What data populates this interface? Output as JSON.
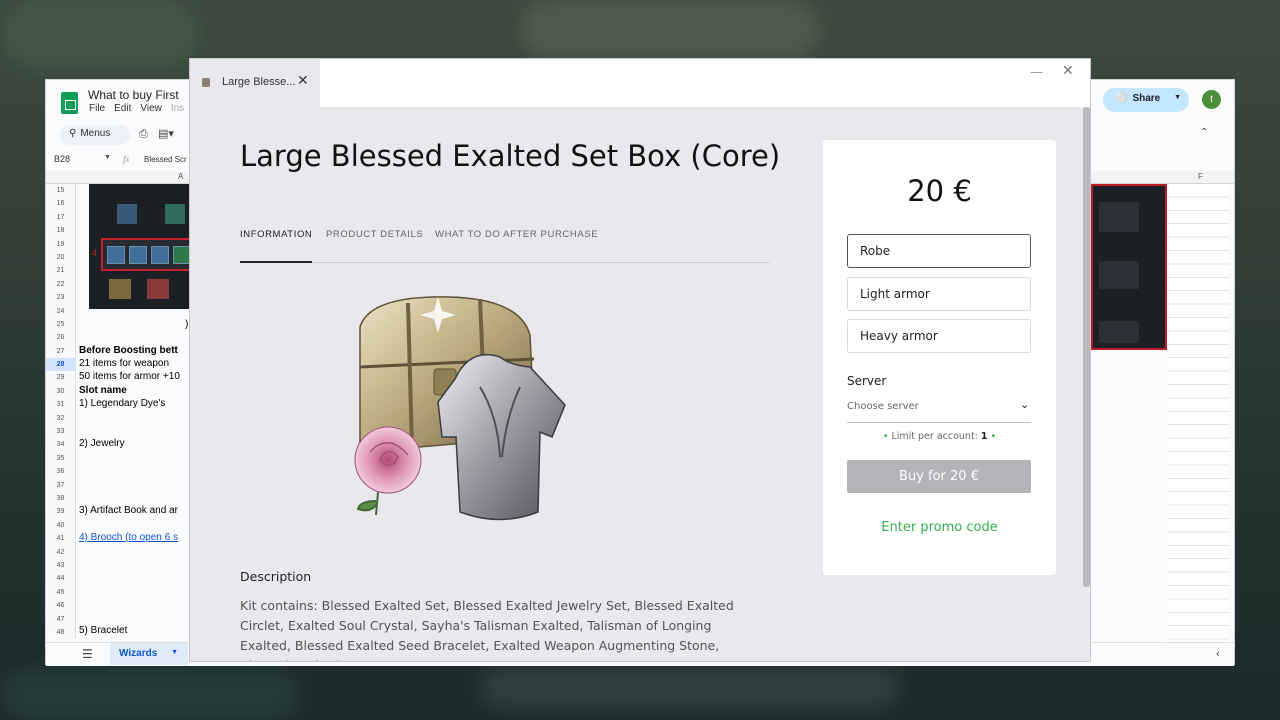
{
  "spreadsheet": {
    "title": "What to buy First",
    "menus": [
      "File",
      "Edit",
      "View",
      "Ins"
    ],
    "search_menus_label": "Menus",
    "name_box": "B28",
    "formula_value": "Blessed Scr",
    "column_a": "A",
    "column_f": "F",
    "share_label": "Share",
    "avatar_letter": "t",
    "row_numbers": [
      "15",
      "16",
      "17",
      "18",
      "19",
      "20",
      "21",
      "22",
      "23",
      "24",
      "25",
      "26",
      "27",
      "28",
      "29",
      "30",
      "31",
      "32",
      "33",
      "34",
      "35",
      "36",
      "37",
      "38",
      "39",
      "40",
      "41",
      "42",
      "43",
      "44",
      "45",
      "46",
      "47",
      "48"
    ],
    "selected_row": "28",
    "cells": {
      "r25": ")",
      "r27": "Before Boosting bett",
      "r28": "21 items for weapon",
      "r29": "50 items for armor +10",
      "r30": "Slot name",
      "r31": "1) Legendary Dye's",
      "r34": "2) Jewelry",
      "r39": "3) Artifact Book and ar",
      "r41": "4) Brooch (to open 6 s",
      "r48": "5) Bracelet",
      "r20": "4"
    },
    "sheet_tab": "Wizards",
    "icons": {
      "logo": "sheets-logo-icon",
      "search": "search-icon",
      "print": "print-icon",
      "format": "paint-format-icon",
      "share": "globe-icon",
      "collapse": "chevron-up-icon",
      "menu": "hamburger-icon"
    }
  },
  "modal": {
    "tab_title": "Large Blesse...",
    "product_title": "Large Blessed Exalted Set Box (Core)",
    "tabs": [
      "INFORMATION",
      "PRODUCT DETAILS",
      "WHAT TO DO AFTER PURCHASE"
    ],
    "active_tab": "INFORMATION",
    "description_heading": "Description",
    "description_text": "Kit contains: Blessed Exalted Set, Blessed Exalted Jewelry Set, Blessed Exalted Circlet, Exalted Soul Crystal, Sayha's Talisman Exalted, Talisman of Longing Exalted, Blessed Exalted Seed Bracelet, Exalted Weapon Augmenting Stone, Blessed Exalted",
    "card": {
      "price": "20 €",
      "options": [
        "Robe",
        "Light armor",
        "Heavy armor"
      ],
      "selected_option": "Robe",
      "server_label": "Server",
      "server_placeholder": "Choose server",
      "limit_label": "Limit per account:",
      "limit_value": "1",
      "buy_label": "Buy for 20 €",
      "promo_label": "Enter promo code"
    },
    "colors": {
      "accent_green": "#2fb24b",
      "disabled_button": "#b3b3b8"
    }
  }
}
